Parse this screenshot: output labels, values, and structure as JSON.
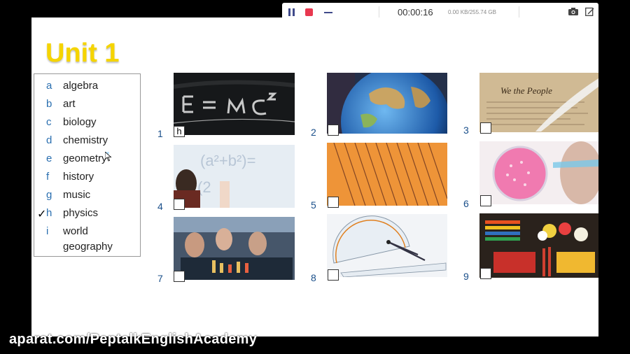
{
  "recorder": {
    "timer": "00:00:16",
    "storage": "0.00 KB/255.74 GB",
    "icons": [
      "pause-icon",
      "stop-icon",
      "minimize-icon",
      "camera-icon",
      "edit-icon"
    ]
  },
  "slide": {
    "title": "Unit 1",
    "words": [
      {
        "letter": "a",
        "word": "algebra",
        "checked": ""
      },
      {
        "letter": "b",
        "word": "art",
        "checked": ""
      },
      {
        "letter": "c",
        "word": "biology",
        "checked": ""
      },
      {
        "letter": "d",
        "word": "chemistry",
        "checked": ""
      },
      {
        "letter": "e",
        "word": "geometry",
        "checked": ""
      },
      {
        "letter": "f",
        "word": "history",
        "checked": ""
      },
      {
        "letter": "g",
        "word": "music",
        "checked": ""
      },
      {
        "letter": "h",
        "word": "physics",
        "checked": "✓"
      },
      {
        "letter": "i",
        "word": "world",
        "word2": "geography",
        "checked": ""
      }
    ],
    "photos": [
      {
        "number": "1",
        "answer": "h",
        "subject": "E=mc2 chalkboard"
      },
      {
        "number": "2",
        "answer": "",
        "subject": "globe"
      },
      {
        "number": "3",
        "answer": "",
        "subject": "We the People document with quill"
      },
      {
        "number": "4",
        "answer": "",
        "subject": "boy writing equation on whiteboard"
      },
      {
        "number": "5",
        "answer": "",
        "subject": "sheet music"
      },
      {
        "number": "6",
        "answer": "",
        "subject": "scientist with petri dish"
      },
      {
        "number": "7",
        "answer": "",
        "subject": "students in chemistry lab"
      },
      {
        "number": "8",
        "answer": "",
        "subject": "protractor and compass"
      },
      {
        "number": "9",
        "answer": "",
        "subject": "paints and pencils"
      }
    ]
  },
  "watermark": "aparat.com/PeptalkEnglishAcademy",
  "colors": {
    "title": "#f5d400",
    "number": "#1a4f8a",
    "letter": "#2a6fb0",
    "stop": "#e8384f"
  }
}
